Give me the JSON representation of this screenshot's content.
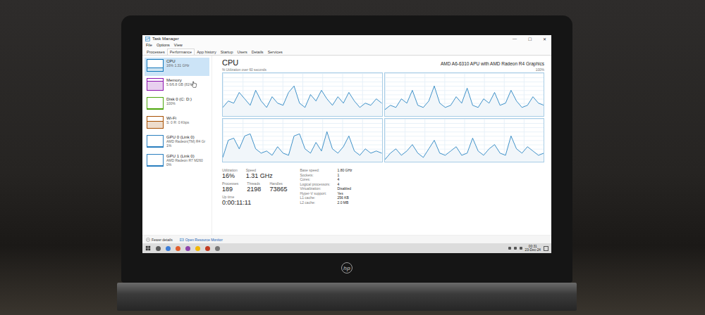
{
  "window": {
    "title": "Task Manager",
    "controls": [
      "—",
      "☐",
      "✕"
    ]
  },
  "menu": [
    "File",
    "Options",
    "View"
  ],
  "tabs": [
    {
      "label": "Processes",
      "selected": false
    },
    {
      "label": "Performance",
      "selected": true
    },
    {
      "label": "App history",
      "selected": false
    },
    {
      "label": "Startup",
      "selected": false
    },
    {
      "label": "Users",
      "selected": false
    },
    {
      "label": "Details",
      "selected": false
    },
    {
      "label": "Services",
      "selected": false
    }
  ],
  "sidebar": {
    "items": [
      {
        "name": "CPU",
        "lines": [
          "16% 1.31 GHz"
        ],
        "selected": true,
        "level": 0.3,
        "color": "#1177bb"
      },
      {
        "name": "Memory",
        "lines": [
          "5.6/6.8 GB (81%)"
        ],
        "selected": false,
        "level": 0.81,
        "color": "#8b12ae"
      },
      {
        "name": "Disk 0 (C: D:)",
        "lines": [
          "100%"
        ],
        "selected": false,
        "level": 0.05,
        "color": "#4da60c"
      },
      {
        "name": "Wi-Fi",
        "lines": [
          "S: 0 R: 0 Kbps"
        ],
        "selected": false,
        "level": 0.6,
        "color": "#a74f01"
      },
      {
        "name": "GPU 0 (Link 0)",
        "lines": [
          "AMD Radeon(TM) R4 Gr",
          "1%"
        ],
        "selected": false,
        "level": 0.02,
        "color": "#2a7fbf"
      },
      {
        "name": "GPU 1 (Link 0)",
        "lines": [
          "AMD Radeon R7 M260",
          "0%"
        ],
        "selected": false,
        "level": 0.0,
        "color": "#2a7fbf"
      }
    ]
  },
  "panel": {
    "title": "CPU",
    "model": "AMD A6-6310 APU with AMD Radeon R4 Graphics",
    "graph_label": "% Utilization over 60 seconds",
    "graph_max": "100%",
    "cores": [
      {
        "values": [
          20,
          35,
          30,
          55,
          40,
          25,
          60,
          35,
          20,
          45,
          30,
          25,
          55,
          70,
          30,
          20,
          50,
          35,
          60,
          40,
          25,
          45,
          30,
          55,
          35,
          20,
          30,
          25,
          40,
          30
        ]
      },
      {
        "values": [
          15,
          25,
          20,
          40,
          30,
          60,
          25,
          20,
          35,
          70,
          30,
          20,
          25,
          45,
          30,
          65,
          25,
          20,
          40,
          30,
          55,
          25,
          30,
          60,
          35,
          20,
          25,
          45,
          30,
          25
        ]
      },
      {
        "values": [
          10,
          50,
          55,
          30,
          60,
          65,
          30,
          20,
          25,
          15,
          35,
          20,
          15,
          60,
          65,
          30,
          20,
          45,
          25,
          70,
          30,
          20,
          35,
          60,
          25,
          15,
          30,
          20,
          25,
          20
        ]
      },
      {
        "values": [
          5,
          20,
          30,
          15,
          25,
          40,
          20,
          10,
          30,
          50,
          20,
          15,
          25,
          35,
          15,
          20,
          55,
          25,
          15,
          30,
          40,
          20,
          15,
          60,
          30,
          20,
          35,
          25,
          15,
          20
        ]
      }
    ]
  },
  "stats": [
    [
      {
        "label": "Utilization",
        "value": "16%"
      },
      {
        "label": "Speed",
        "value": "1.31 GHz"
      }
    ],
    [
      {
        "label": "Processes",
        "value": "189"
      },
      {
        "label": "Threads",
        "value": "2198"
      },
      {
        "label": "Handles",
        "value": "73865"
      }
    ],
    [
      {
        "label": "Up time",
        "value": "0:00:11:11"
      }
    ]
  ],
  "specs": [
    {
      "label": "Base speed:",
      "value": "1.80 GHz"
    },
    {
      "label": "Sockets:",
      "value": "1"
    },
    {
      "label": "Cores:",
      "value": "4"
    },
    {
      "label": "Logical processors:",
      "value": "4"
    },
    {
      "label": "Virtualization:",
      "value": "Disabled"
    },
    {
      "label": "Hyper-V support:",
      "value": "Yes"
    },
    {
      "label": "L1 cache:",
      "value": "256 KB"
    },
    {
      "label": "L2 cache:",
      "value": "2.0 MB"
    }
  ],
  "footer": {
    "fewer": "Fewer details",
    "monitor": "Open Resource Monitor"
  },
  "taskbar": {
    "time": "00:31",
    "date": "23-Dec-24"
  },
  "brand": "hp"
}
